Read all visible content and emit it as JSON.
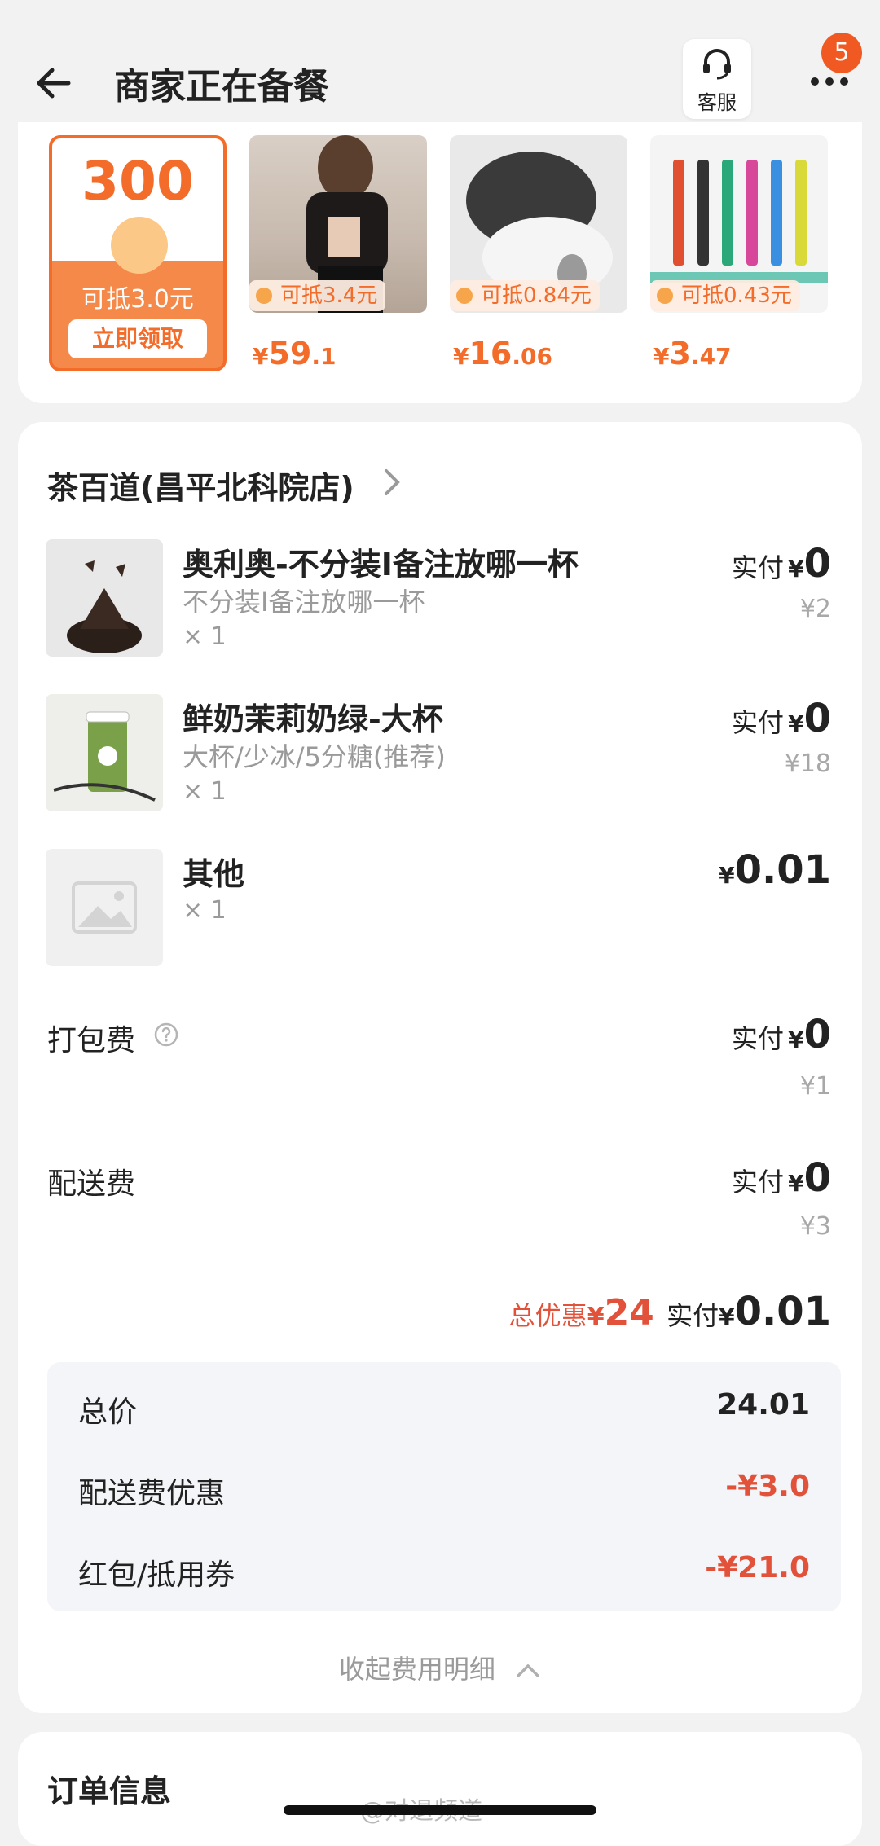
{
  "header": {
    "title": "商家正在备餐",
    "customer_service_label": "客服",
    "notification_count": "5"
  },
  "promo": {
    "coupon": {
      "amount": "300",
      "deduct_text": "可抵3.0元",
      "claim_label": "立即领取"
    },
    "products": [
      {
        "deduct_text": "可抵3.4元",
        "price_yen": "¥",
        "price_int": "59",
        "price_dec": ".1",
        "image": "clothing-photo"
      },
      {
        "deduct_text": "可抵0.84元",
        "price_yen": "¥",
        "price_int": "16",
        "price_dec": ".06",
        "image": "fur-tail-photo"
      },
      {
        "deduct_text": "可抵0.43元",
        "price_yen": "¥",
        "price_int": "3",
        "price_dec": ".47",
        "image": "colored-needles-photo"
      }
    ]
  },
  "order": {
    "shop_name": "茶百道(昌平北科院店)",
    "items": [
      {
        "name": "奥利奥-不分装I备注放哪一杯",
        "spec": "不分装I备注放哪一杯",
        "qty": "× 1",
        "pay_label": "实付",
        "yen": "¥",
        "pay_value": "0",
        "original": "¥2"
      },
      {
        "name": "鲜奶茉莉奶绿-大杯",
        "spec": "大杯/少冰/5分糖(推荐)",
        "qty": "× 1",
        "pay_label": "实付",
        "yen": "¥",
        "pay_value": "0",
        "original": "¥18"
      },
      {
        "name": "其他",
        "qty": "× 1",
        "yen": "¥",
        "pay_value": "0.01"
      }
    ],
    "fees": [
      {
        "label": "打包费",
        "pay_label": "实付",
        "yen": "¥",
        "pay_value": "0",
        "original": "¥1"
      },
      {
        "label": "配送费",
        "pay_label": "实付",
        "yen": "¥",
        "pay_value": "0",
        "original": "¥3"
      }
    ],
    "summary": {
      "discount_label": "总优惠",
      "discount_yen": "¥",
      "discount_value": "24",
      "pay_label": "实付",
      "pay_yen": "¥",
      "pay_value": "0.01"
    },
    "breakdown": [
      {
        "label": "总价",
        "value": "24.01",
        "color": "#222222"
      },
      {
        "label": "配送费优惠",
        "value": "-¥3.0",
        "color": "#e2523a"
      },
      {
        "label": "红包/抵用券",
        "value": "-¥21.0",
        "color": "#e2523a"
      }
    ],
    "collapse_label": "收起费用明细"
  },
  "order_info": {
    "title": "订单信息"
  },
  "watermark": "@对退频道",
  "colors": {
    "accent": "#f36c2a",
    "discount_red": "#e2523a",
    "background": "#f2f2f2"
  }
}
